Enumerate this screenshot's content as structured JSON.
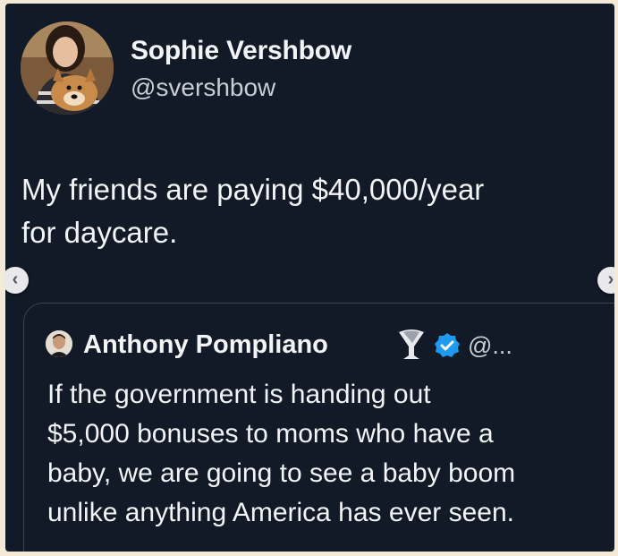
{
  "author": {
    "name": "Sophie Vershbow",
    "handle": "@svershbow"
  },
  "tweet": {
    "lines": [
      "My friends are paying $40,000/year",
      "for daycare."
    ]
  },
  "navigation": {
    "prev_icon": "chevron-left-icon",
    "next_icon": "chevron-right-icon",
    "prev_glyph": "‹",
    "next_glyph": "›"
  },
  "quoted_tweet": {
    "name": "Anthony Pompliano",
    "handle": "@...",
    "lines": [
      "If the government is handing out",
      "$5,000 bonuses to moms who have a",
      "baby, we are going to see a baby boom",
      "unlike anything America has ever seen."
    ],
    "verified_color": "#1d9bf0"
  },
  "colors": {
    "background": "#121a27",
    "text": "#f2f4f7",
    "muted": "#c9ced6",
    "card_border": "#3a4352"
  }
}
